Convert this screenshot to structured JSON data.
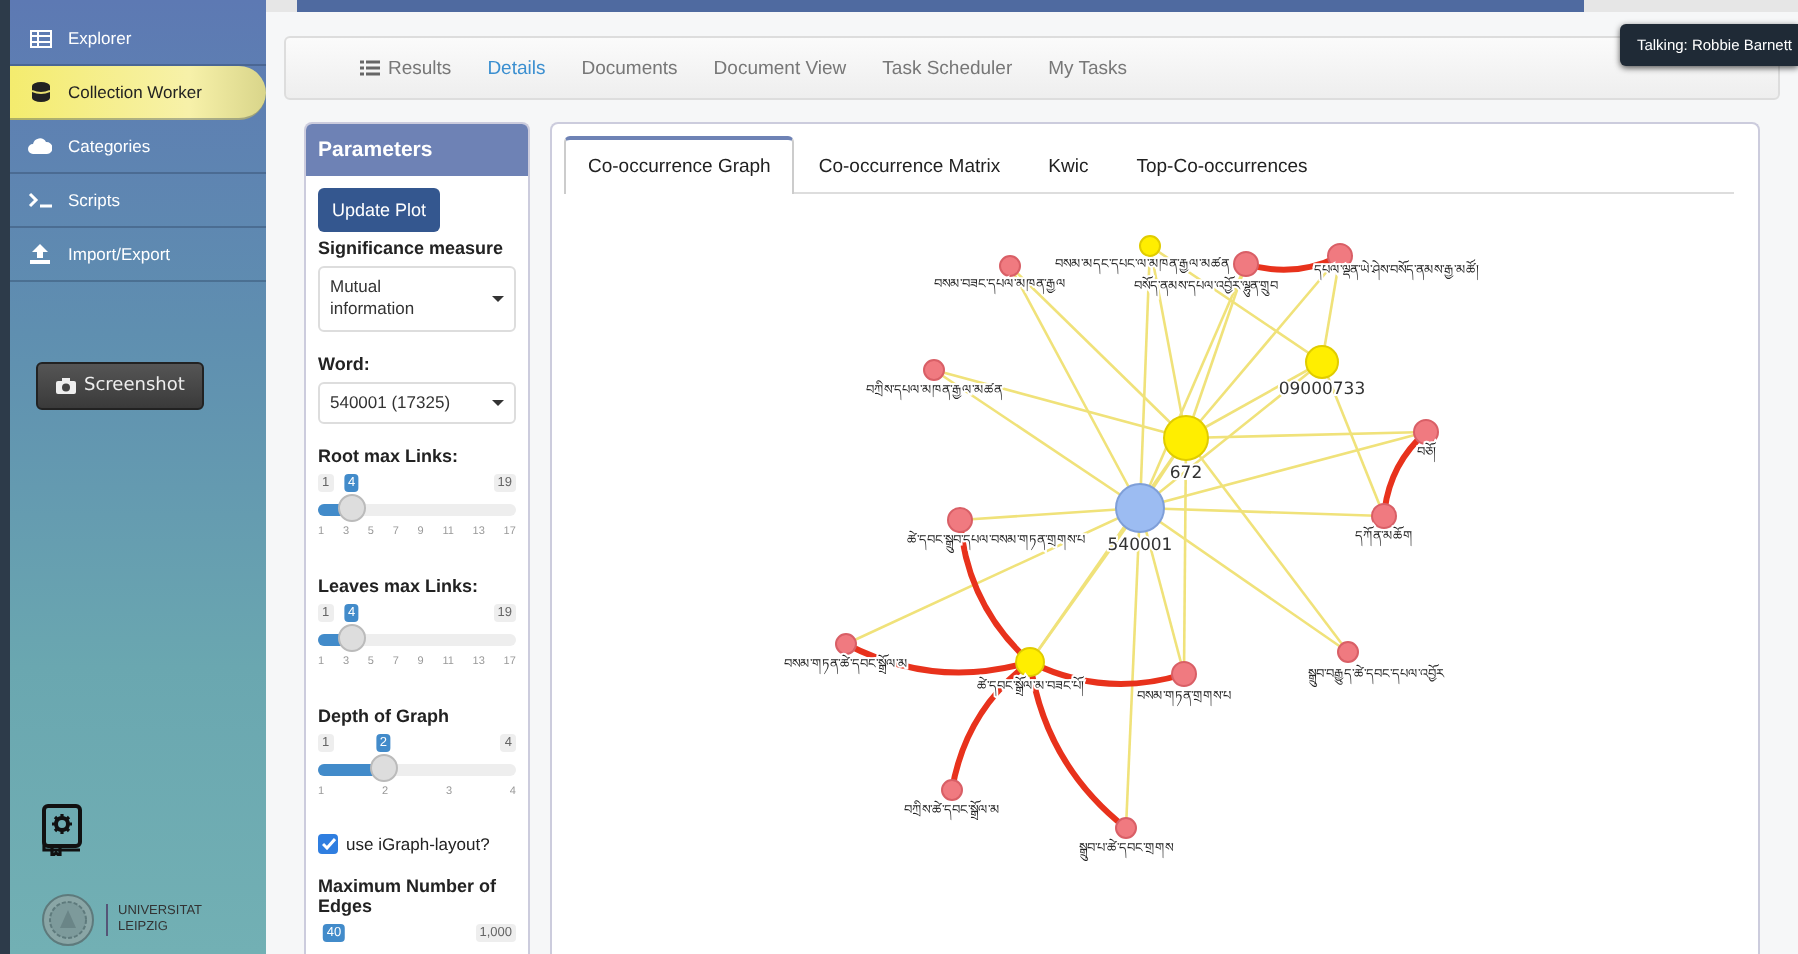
{
  "sidebar": {
    "items": [
      {
        "label": "Explorer",
        "kind": "table",
        "selected": false
      },
      {
        "label": "Collection Worker",
        "kind": "database",
        "selected": true
      },
      {
        "label": "Categories",
        "kind": "cloud",
        "selected": false
      },
      {
        "label": "Scripts",
        "kind": "terminal",
        "selected": false
      },
      {
        "label": "Import/Export",
        "kind": "upload",
        "selected": false
      }
    ],
    "screenshot_button": "Screenshot",
    "logo_text": "UNIVERSITAT LEIPZIG"
  },
  "nav": {
    "tabs": [
      {
        "label": "Results",
        "kind": "list",
        "selected": false
      },
      {
        "label": "Details",
        "kind": "plain",
        "selected": true
      },
      {
        "label": "Documents",
        "kind": "plain",
        "selected": false
      },
      {
        "label": "Document View",
        "kind": "plain",
        "selected": false
      },
      {
        "label": "Task Scheduler",
        "kind": "plain",
        "selected": false
      },
      {
        "label": "My Tasks",
        "kind": "plain",
        "selected": false
      }
    ]
  },
  "notification": "Talking: Robbie Barnett",
  "parameters": {
    "title": "Parameters",
    "update_button": "Update Plot",
    "measure": {
      "label": "Significance measure",
      "value": "Mutual information"
    },
    "word": {
      "label": "Word:",
      "value": "540001 (17325)"
    },
    "sliders": [
      {
        "label": "Root max Links:",
        "min": "1",
        "max": "19",
        "value": "4",
        "level": 0.17,
        "ticks": [
          "1",
          "3",
          "5",
          "7",
          "9",
          "11",
          "13",
          "17"
        ]
      },
      {
        "label": "Leaves max Links:",
        "min": "1",
        "max": "19",
        "value": "4",
        "level": 0.17,
        "ticks": [
          "1",
          "3",
          "5",
          "7",
          "9",
          "11",
          "13",
          "17"
        ]
      },
      {
        "label": "Depth of Graph",
        "min": "1",
        "max": "4",
        "value": "2",
        "level": 0.33,
        "ticks": [
          "1",
          "2",
          "3",
          "4"
        ]
      }
    ],
    "layout_checkbox": {
      "label": "use iGraph-layout?",
      "checked": true
    },
    "max_edges": {
      "label": "Maximum Number of Edges",
      "value": "40",
      "max": "1,000"
    }
  },
  "graph": {
    "tabs": [
      {
        "label": "Co-occurrence Graph",
        "selected": true
      },
      {
        "label": "Co-occurrence Matrix",
        "selected": false
      },
      {
        "label": "Kwic",
        "selected": false
      },
      {
        "label": "Top-Co-occurrences",
        "selected": false
      }
    ],
    "nodes": [
      {
        "label": "540001",
        "kind": "root"
      },
      {
        "label": "672",
        "kind": "hub"
      },
      {
        "label": "09000733",
        "kind": "hub"
      },
      {
        "label": "བསམ་མདང་དཔང་ལ་མཁན་རྒྱལ་མཚན",
        "kind": "link"
      },
      {
        "label": "བསམ་བཟང་དཔལ་མཁན་རྒྱལ",
        "kind": "leaf"
      },
      {
        "label": "བསོད་ནམས་དཔལ་འབྱོར་ལྷུན་གྲུབ",
        "kind": "leaf"
      },
      {
        "label": "དཔལ་ལྡན་ཡེ་ཤེས་བསོད་ནམས་རྒྱ་མཚོ།",
        "kind": "leaf"
      },
      {
        "label": "བཀྲིས་དཔལ་མཁན་རྒྱལ་མཚན",
        "kind": "leaf"
      },
      {
        "label": "བཅོ།",
        "kind": "leaf"
      },
      {
        "label": "ཚེ་དབང་སྒྲུབ་དཔལ་བསམ་གཏན་གྲགས་པ",
        "kind": "leaf"
      },
      {
        "label": "དཀོན་མཆོག",
        "kind": "leaf"
      },
      {
        "label": "ཚེ་དབང་སྒྲོལ་མ་བཟང་པོ།",
        "kind": "link"
      },
      {
        "label": "བསམ་གཏན་ཚེ་དབང་སྒྲོལ་མ",
        "kind": "leaf"
      },
      {
        "label": "བསམ་གཏན་གྲགས་པ",
        "kind": "leaf"
      },
      {
        "label": "སྒྲུབ་བརྒྱུད་ཚེ་དབང་དཔལ་འབྱོར",
        "kind": "leaf"
      },
      {
        "label": "བཀྲིས་ཚེ་དབང་སྒྲོལ་མ",
        "kind": "leaf"
      },
      {
        "label": "སྒྲུབ་པ་ཚེ་དབང་གྲགས",
        "kind": "leaf"
      }
    ],
    "edges": [
      {
        "strong": false
      },
      {
        "strong": false
      },
      {
        "strong": false
      },
      {
        "strong": false
      },
      {
        "strong": false
      },
      {
        "strong": false
      },
      {
        "strong": false
      },
      {
        "strong": false
      },
      {
        "strong": false
      },
      {
        "strong": false
      },
      {
        "strong": false
      },
      {
        "strong": false
      },
      {
        "strong": false
      },
      {
        "strong": false
      },
      {
        "strong": false
      },
      {
        "strong": false
      },
      {
        "strong": false
      },
      {
        "strong": false
      },
      {
        "strong": false
      },
      {
        "strong": false
      },
      {
        "strong": false
      },
      {
        "strong": false
      },
      {
        "strong": false
      },
      {
        "strong": false
      },
      {
        "strong": false
      },
      {
        "strong": false
      },
      {
        "strong": false
      },
      {
        "strong": true
      },
      {
        "strong": true
      },
      {
        "strong": true
      },
      {
        "strong": true
      },
      {
        "strong": true
      },
      {
        "strong": true
      },
      {
        "strong": true
      }
    ]
  }
}
